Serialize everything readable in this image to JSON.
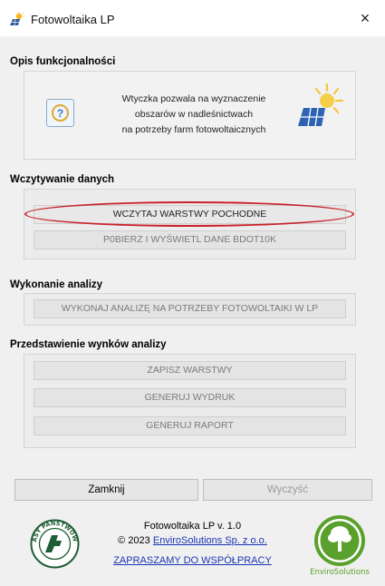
{
  "window": {
    "title": "Fotowoltaika LP",
    "close_symbol": "×"
  },
  "description": {
    "heading": "Opis funkcjonalności",
    "line1": "Wtyczka pozwala na wyznaczenie",
    "line2": "obszarów w nadleśnictwach",
    "line3": "na potrzeby farm fotowoltaicznych",
    "help_symbol": "?"
  },
  "data_loading": {
    "heading": "Wczytywanie danych",
    "load_layers_label": "WCZYTAJ WARSTWY POCHODNE",
    "fetch_bdot_label": "P0BIERZ I WYŚWIETL DANE BDOT10K"
  },
  "analysis": {
    "heading": "Wykonanie analizy",
    "run_label": "WYKONAJ ANALIZĘ NA POTRZEBY FOTOWOLTAIKI W LP"
  },
  "results": {
    "heading": "Przedstawienie wynków analizy",
    "save_layers_label": "ZAPISZ WARSTWY",
    "print_label": "GENERUJ WYDRUK",
    "report_label": "GENERUJ RAPORT"
  },
  "actions": {
    "close_label": "Zamknij",
    "clear_label": "Wyczyść"
  },
  "footer": {
    "version": "Fotowoltaika LP v. 1.0",
    "copyright_prefix": "© 2023 ",
    "company_link": "EnviroSolutions Sp. z o.o.",
    "cooperation_link": "ZAPRASZAMY DO WSPÓŁPRACY",
    "lasy_logo_text": "LASY PAŃSTWOWE",
    "enviro_logo_text": "EnviroSolutions"
  },
  "colors": {
    "highlight_oval": "#c8222b",
    "link": "#1a35b5",
    "enviro_green": "#5aa02c"
  }
}
